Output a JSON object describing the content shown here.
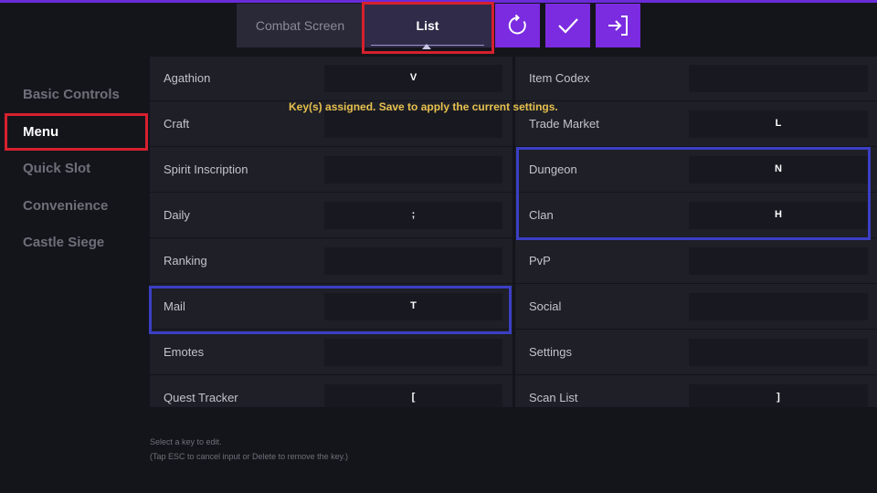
{
  "tabs": {
    "combat": "Combat Screen",
    "list": "List"
  },
  "buttons": {
    "reset_icon": "reset-icon",
    "confirm_icon": "check-icon",
    "exit_icon": "exit-icon"
  },
  "sidebar": [
    {
      "label": "Basic Controls",
      "active": false
    },
    {
      "label": "Menu",
      "active": true
    },
    {
      "label": "Quick Slot",
      "active": false
    },
    {
      "label": "Convenience",
      "active": false
    },
    {
      "label": "Castle Siege",
      "active": false
    }
  ],
  "notice": "Key(s) assigned. Save to apply the current settings.",
  "left_column": [
    {
      "label": "Agathion",
      "key": "V"
    },
    {
      "label": "Craft",
      "key": ""
    },
    {
      "label": "Spirit Inscription",
      "key": ""
    },
    {
      "label": "Daily",
      "key": ";"
    },
    {
      "label": "Ranking",
      "key": ""
    },
    {
      "label": "Mail",
      "key": "T"
    },
    {
      "label": "Emotes",
      "key": ""
    },
    {
      "label": "Quest Tracker",
      "key": "["
    }
  ],
  "right_column": [
    {
      "label": "Item Codex",
      "key": ""
    },
    {
      "label": "Trade Market",
      "key": "L"
    },
    {
      "label": "Dungeon",
      "key": "N"
    },
    {
      "label": "Clan",
      "key": "H"
    },
    {
      "label": "PvP",
      "key": ""
    },
    {
      "label": "Social",
      "key": ""
    },
    {
      "label": "Settings",
      "key": ""
    },
    {
      "label": "Scan List",
      "key": "]"
    }
  ],
  "help": {
    "line1": "Select a key to edit.",
    "line2": "(Tap ESC to cancel input or Delete to remove the key.)"
  },
  "colors": {
    "accent": "#7b2be0",
    "highlight_red": "#d6202e",
    "highlight_blue": "#3b3fc4",
    "notice": "#e7c14e"
  }
}
